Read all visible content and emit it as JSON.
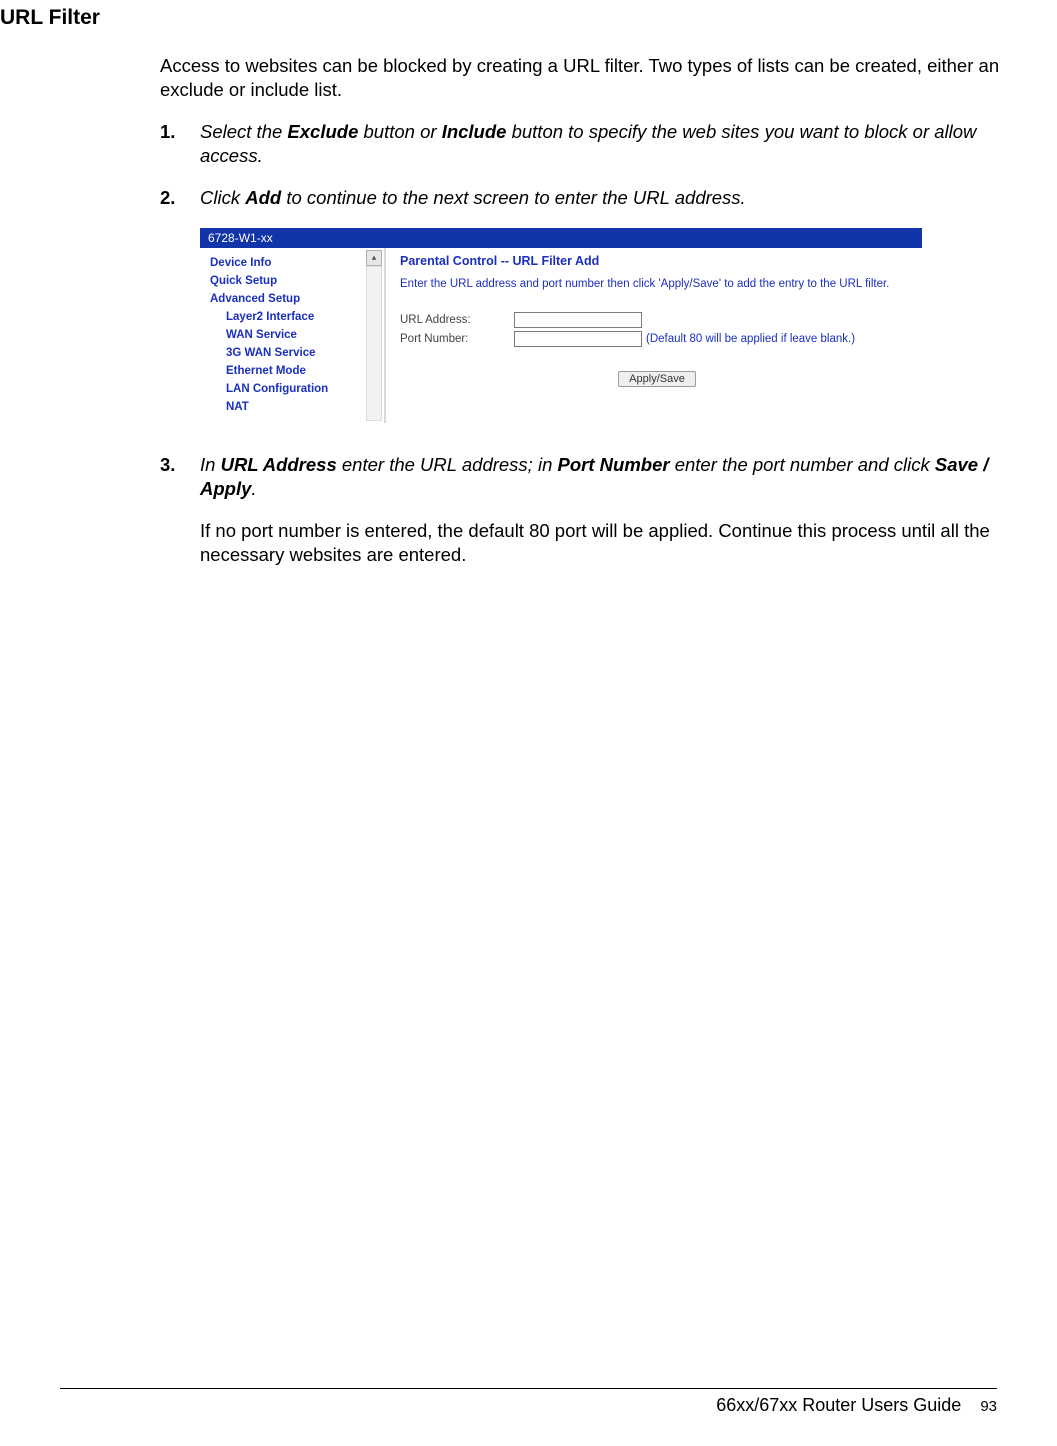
{
  "section_title": "URL Filter",
  "intro": "Access to websites can be blocked by creating a URL filter. Two types of lists can be created, either an exclude or include list.",
  "steps": {
    "s1_num": "1.",
    "s1_a": "Select the ",
    "s1_b1": "Exclude",
    "s1_c": " button or ",
    "s1_b2": "Include",
    "s1_d": " button to specify the web sites you want to block or allow access.",
    "s2_num": "2.",
    "s2_a": "Click ",
    "s2_b1": "Add",
    "s2_c": " to continue to the next screen to enter the URL address.",
    "s3_num": "3.",
    "s3_a": "In ",
    "s3_b1": "URL Address",
    "s3_c": " enter the URL address; in ",
    "s3_b2": "Port Number",
    "s3_d": " enter the port number and click ",
    "s3_b3": "Save / Apply",
    "s3_e": ".",
    "s3_note": "If no port number is entered, the default 80 port will be applied. Continue this process until all the necessary websites are entered."
  },
  "shot": {
    "titlebar": "6728-W1-xx",
    "nav": {
      "device_info": "Device Info",
      "quick_setup": "Quick Setup",
      "advanced_setup": "Advanced Setup",
      "layer2": "Layer2 Interface",
      "wan": "WAN Service",
      "g3": "3G WAN Service",
      "eth": "Ethernet Mode",
      "lan": "LAN Configuration",
      "nat": "NAT"
    },
    "content": {
      "heading": "Parental Control -- URL Filter Add",
      "desc": "Enter the URL address and port number then click 'Apply/Save' to add the entry to the URL filter.",
      "url_label": "URL Address:",
      "port_label": "Port Number:",
      "port_hint": "(Default 80 will be applied if leave blank.)",
      "apply_btn": "Apply/Save"
    }
  },
  "footer": {
    "guide": "66xx/67xx Router Users Guide",
    "page": "93"
  }
}
